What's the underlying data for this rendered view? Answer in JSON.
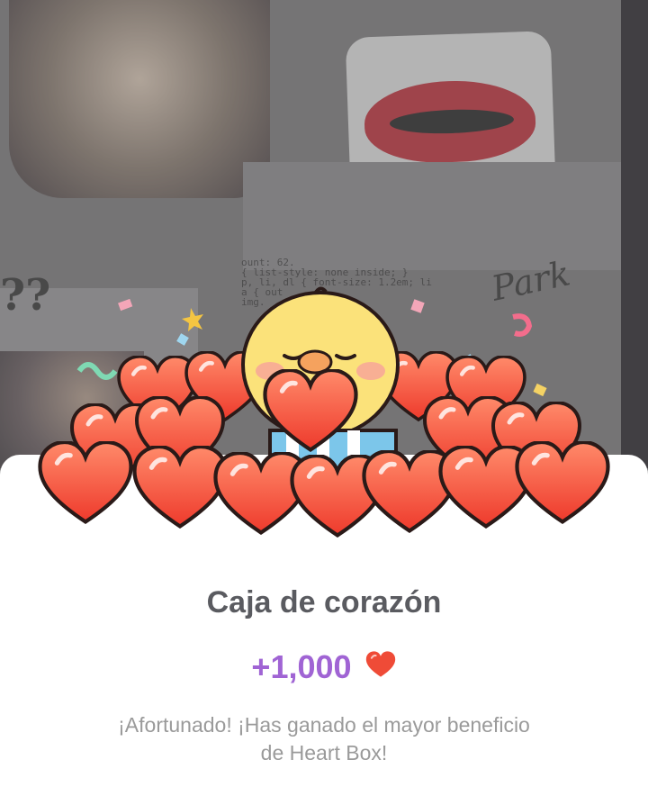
{
  "background": {
    "scribble_left": "??",
    "scribble_right": "Park",
    "code_lines": [
      "ount: 62.",
      "{ list-style: none inside; }",
      "p, li, dl { font-size: 1.2em; li",
      "a { out",
      "img."
    ]
  },
  "sheet": {
    "title": "Caja de corazón",
    "reward_amount": "+1,000",
    "message_line1": "¡Afortunado! ¡Has ganado el mayor beneficio",
    "message_line2": "de Heart Box!"
  },
  "colors": {
    "reward": "#a064d4",
    "title": "#5a5b60",
    "message": "#9a9a9a",
    "heart": "#ef4b37"
  },
  "icons": {
    "reward_icon": "heart-icon",
    "mascot": "chick-mascot-icon"
  }
}
